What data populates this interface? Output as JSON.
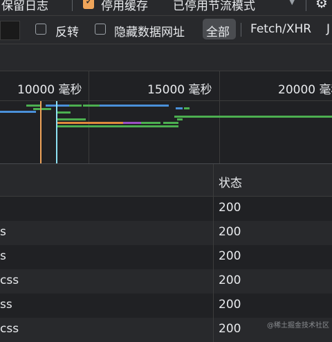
{
  "toolbar": {
    "preserve_log_label": "保留日志",
    "disable_cache_label": "停用缓存",
    "throttle_label": "已停用节流模式"
  },
  "filterbar": {
    "invert_label": "反转",
    "hide_data_urls_label": "隐藏数据网址",
    "all_label": "全部",
    "fetch_xhr_label": "Fetch/XHR",
    "js_label": "J"
  },
  "timeline": {
    "ticks": [
      "10000 毫秒",
      "15000 毫秒",
      "20000 毫秒"
    ]
  },
  "table": {
    "status_header": "状态",
    "rows": [
      {
        "name": "",
        "status": "200"
      },
      {
        "name": "s",
        "status": "200"
      },
      {
        "name": "s",
        "status": "200"
      },
      {
        "name": "css",
        "status": "200"
      },
      {
        "name": "ss",
        "status": "200"
      },
      {
        "name": "css",
        "status": "200"
      }
    ]
  },
  "watermark": "@稀土掘金技术社区",
  "colors": {
    "accent_orange": "#f0a55a",
    "bar_blue": "#4a90d9",
    "bar_green": "#4caf50",
    "bar_orange": "#e08a3c",
    "bar_purple": "#9b4fc4"
  }
}
